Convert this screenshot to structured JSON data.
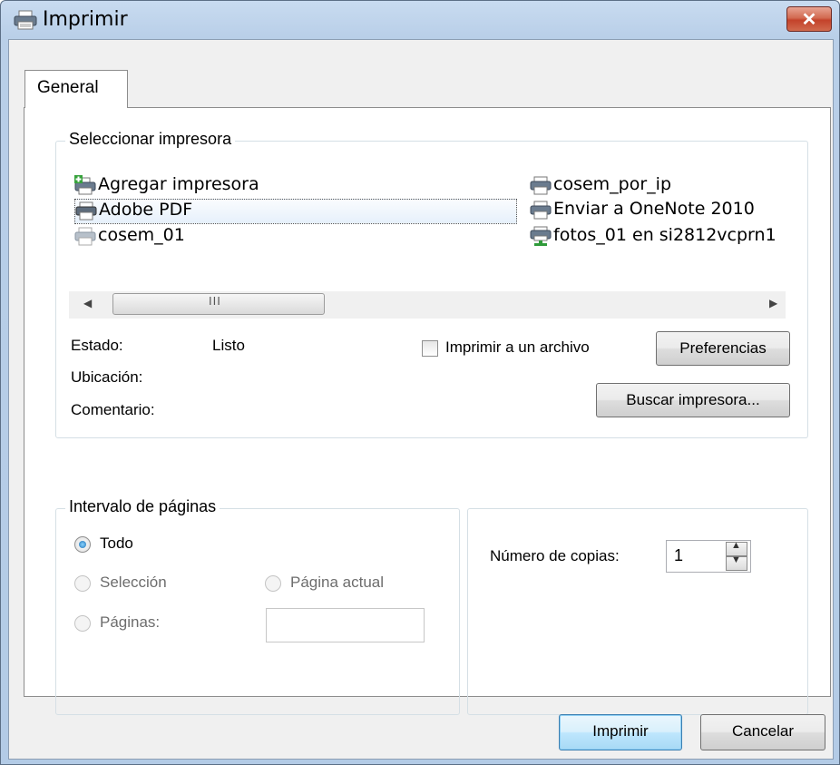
{
  "window": {
    "title": "Imprimir",
    "close_glyph": "✕"
  },
  "tabs": [
    {
      "label": "General"
    }
  ],
  "select_printer": {
    "legend": "Seleccionar impresora",
    "printers": [
      {
        "name": "Agregar impresora",
        "icon": "add-printer-icon"
      },
      {
        "name": "Adobe PDF",
        "icon": "printer-icon",
        "selected": true
      },
      {
        "name": "cosem_01",
        "icon": "printer-gray-icon"
      },
      {
        "name": "cosem_por_ip",
        "icon": "printer-icon"
      },
      {
        "name": "Enviar a OneNote 2010",
        "icon": "printer-icon"
      },
      {
        "name": "fotos_01 en si2812vcprn1",
        "icon": "network-printer-icon"
      }
    ],
    "scroll": {
      "left_arrow": "◀",
      "right_arrow": "▶",
      "thumb_grip": "III"
    },
    "status_label": "Estado:",
    "status_value": "Listo",
    "location_label": "Ubicación:",
    "comment_label": "Comentario:",
    "print_to_file_label": "Imprimir a un archivo",
    "preferences_button": "Preferencias",
    "find_printer_button": "Buscar impresora..."
  },
  "page_range": {
    "legend": "Intervalo de páginas",
    "all_label": "Todo",
    "selection_label": "Selección",
    "current_page_label": "Página actual",
    "pages_label": "Páginas:"
  },
  "copies": {
    "label": "Número de copias:",
    "value": "1"
  },
  "footer": {
    "print_button": "Imprimir",
    "cancel_button": "Cancelar"
  }
}
